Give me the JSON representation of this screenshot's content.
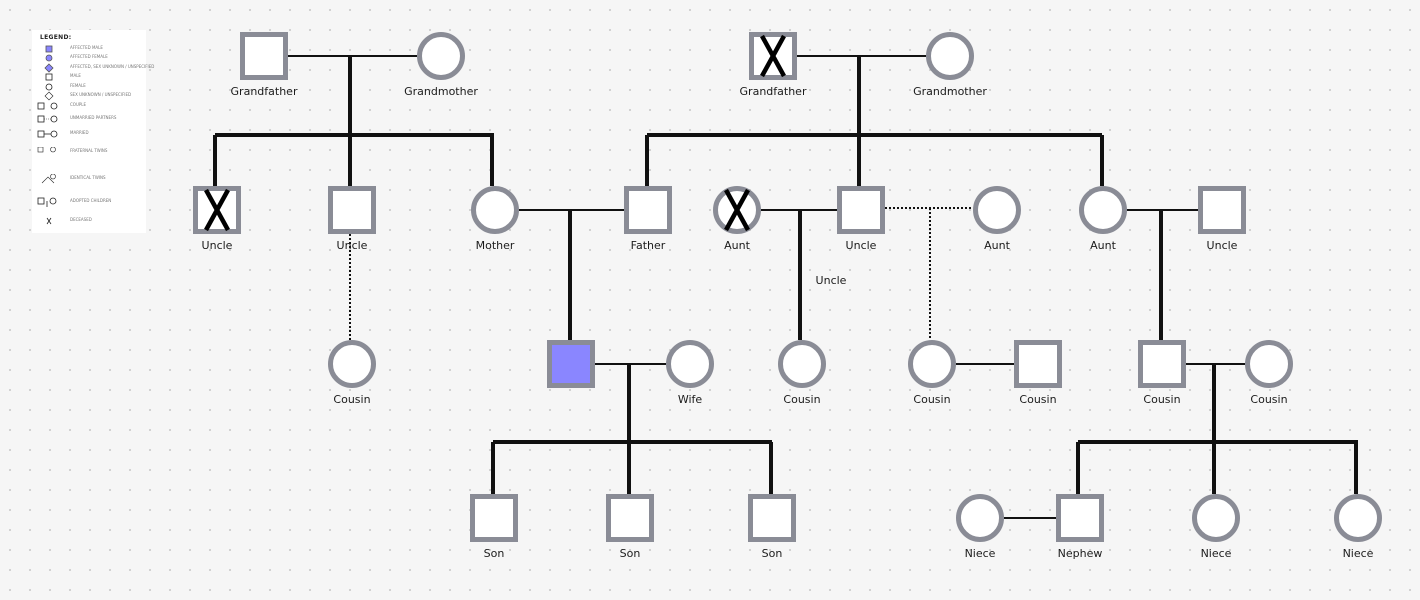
{
  "legend": {
    "title": "LEGEND:",
    "items": [
      {
        "symbol": "affected-male",
        "label": "AFFECTED MALE"
      },
      {
        "symbol": "affected-female",
        "label": "AFFECTED FEMALE"
      },
      {
        "symbol": "affected-unknown",
        "label": "AFFECTED, SEX UNKNOWN / UNSPECIFIED"
      },
      {
        "symbol": "male",
        "label": "MALE"
      },
      {
        "symbol": "female",
        "label": "FEMALE"
      },
      {
        "symbol": "unknown",
        "label": "SEX UNKNOWN / UNSPECIFIED"
      },
      {
        "symbol": "couple",
        "label": "COUPLE"
      },
      {
        "symbol": "partners",
        "label": "UNMARRIED PARTNERS"
      },
      {
        "symbol": "married",
        "label": "MARRIED"
      },
      {
        "symbol": "twins-fraternal",
        "label": "FRATERNAL TWINS"
      },
      {
        "symbol": "twins-identical",
        "label": "IDENTICAL TWINS"
      },
      {
        "symbol": "adopted",
        "label": "ADOPTED CHILDREN"
      },
      {
        "symbol": "deceased",
        "label": "DECEASED"
      }
    ]
  },
  "colors": {
    "outline": "#8a8c96",
    "line": "#111111",
    "affected": "#8a86ff",
    "fill": "#ffffff"
  },
  "people": [
    {
      "id": "gf1",
      "label": "Grandfather",
      "sex": "male",
      "deceased": false,
      "affected": false
    },
    {
      "id": "gm1",
      "label": "Grandmother",
      "sex": "female",
      "deceased": false,
      "affected": false
    },
    {
      "id": "gf2",
      "label": "Grandfather",
      "sex": "male",
      "deceased": true,
      "affected": false
    },
    {
      "id": "gm2",
      "label": "Grandmother",
      "sex": "female",
      "deceased": false,
      "affected": false
    },
    {
      "id": "uncle1",
      "label": "Uncle",
      "sex": "male",
      "deceased": true,
      "affected": false
    },
    {
      "id": "uncle2",
      "label": "Uncle",
      "sex": "male",
      "deceased": false,
      "affected": false
    },
    {
      "id": "mother",
      "label": "Mother",
      "sex": "female",
      "deceased": false,
      "affected": false
    },
    {
      "id": "father",
      "label": "Father",
      "sex": "male",
      "deceased": false,
      "affected": false
    },
    {
      "id": "aunt1",
      "label": "Aunt",
      "sex": "female",
      "deceased": true,
      "affected": false
    },
    {
      "id": "uncle3",
      "label": "Uncle",
      "sex": "male",
      "deceased": false,
      "affected": false
    },
    {
      "id": "aunt2",
      "label": "Aunt",
      "sex": "female",
      "deceased": false,
      "affected": false
    },
    {
      "id": "aunt3",
      "label": "Aunt",
      "sex": "female",
      "deceased": false,
      "affected": false
    },
    {
      "id": "uncle4",
      "label": "Uncle",
      "sex": "male",
      "deceased": false,
      "affected": false
    },
    {
      "id": "cousin1",
      "label": "Cousin",
      "sex": "female",
      "deceased": false,
      "affected": false
    },
    {
      "id": "proband",
      "label": "",
      "sex": "male",
      "deceased": false,
      "affected": true
    },
    {
      "id": "wife",
      "label": "Wife",
      "sex": "female",
      "deceased": false,
      "affected": false
    },
    {
      "id": "cousin2",
      "label": "Cousin",
      "sex": "female",
      "deceased": false,
      "affected": false
    },
    {
      "id": "cousin3",
      "label": "Cousin",
      "sex": "female",
      "deceased": false,
      "affected": false
    },
    {
      "id": "cousin4",
      "label": "Cousin",
      "sex": "male",
      "deceased": false,
      "affected": false
    },
    {
      "id": "cousin5",
      "label": "Cousin",
      "sex": "male",
      "deceased": false,
      "affected": false
    },
    {
      "id": "cousin6",
      "label": "Cousin",
      "sex": "female",
      "deceased": false,
      "affected": false
    },
    {
      "id": "son1",
      "label": "Son",
      "sex": "male",
      "deceased": false,
      "affected": false
    },
    {
      "id": "son2",
      "label": "Son",
      "sex": "male",
      "deceased": false,
      "affected": false
    },
    {
      "id": "son3",
      "label": "Son",
      "sex": "male",
      "deceased": false,
      "affected": false
    },
    {
      "id": "niece1",
      "label": "Niece",
      "sex": "female",
      "deceased": false,
      "affected": false
    },
    {
      "id": "nephew",
      "label": "Nephew",
      "sex": "male",
      "deceased": false,
      "affected": false
    },
    {
      "id": "niece2",
      "label": "Niece",
      "sex": "female",
      "deceased": false,
      "affected": false
    },
    {
      "id": "niece3",
      "label": "Niece",
      "sex": "female",
      "deceased": false,
      "affected": false
    }
  ],
  "annotations": [
    {
      "id": "floating-uncle",
      "text": "Uncle"
    }
  ]
}
